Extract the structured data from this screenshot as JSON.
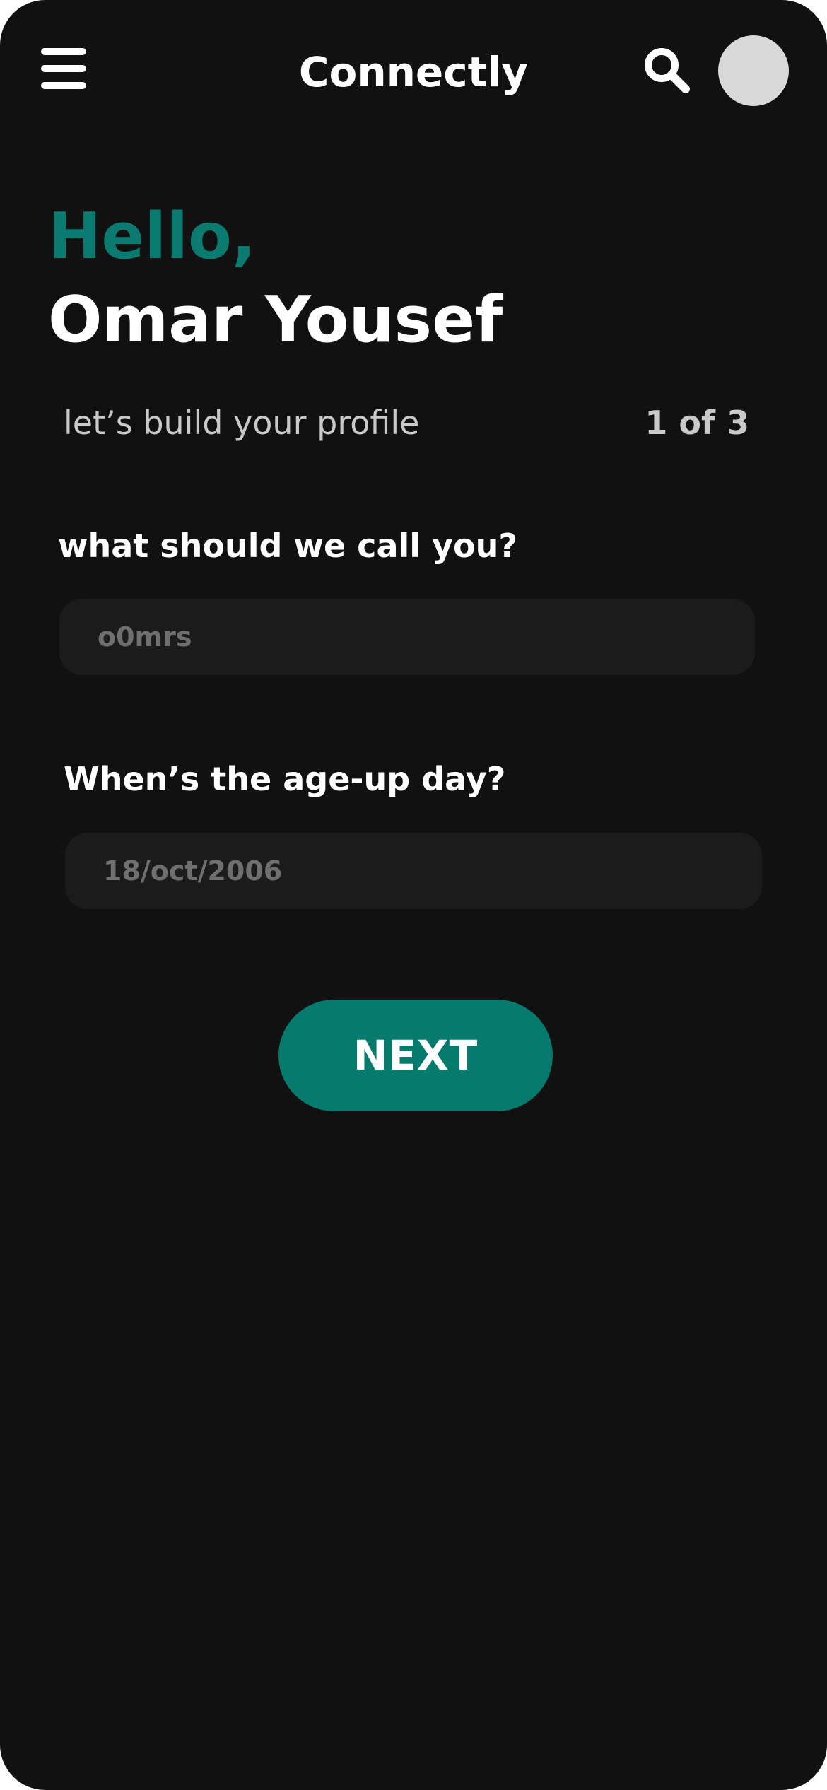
{
  "header": {
    "app_title": "Connectly",
    "menu_icon": "hamburger-menu-icon",
    "search_icon": "search-icon",
    "avatar": "avatar-placeholder"
  },
  "greeting": {
    "hello": "Hello,",
    "name": "Omar Yousef"
  },
  "profile_setup": {
    "subtitle": "let’s build your profile",
    "step_counter": "1 of 3"
  },
  "form": {
    "nickname": {
      "label": "what should we call you?",
      "placeholder": "o0mrs"
    },
    "birthday": {
      "label": "When’s the age-up day?",
      "placeholder": "18/oct/2006"
    },
    "next_label": "NEXT"
  },
  "colors": {
    "background": "#111111",
    "accent": "#077a6e",
    "input_background": "#1b1b1b",
    "avatar": "#d9d9d9"
  }
}
